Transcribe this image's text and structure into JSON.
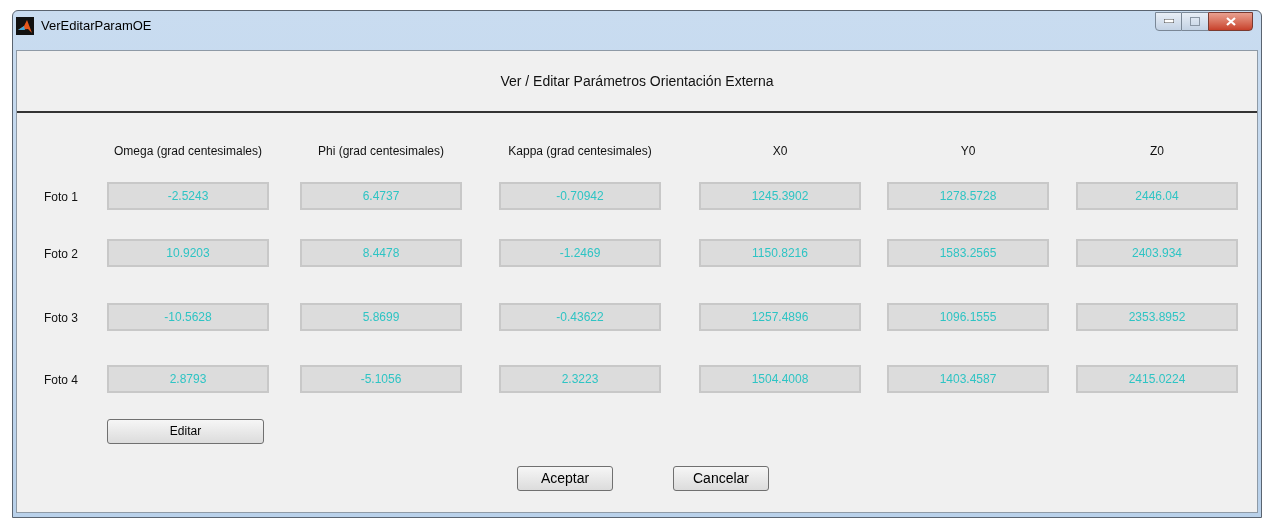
{
  "window": {
    "title": "VerEditarParamOE"
  },
  "header": "Ver / Editar Parámetros Orientación Externa",
  "columns": [
    "Omega (grad centesimales)",
    "Phi (grad centesimales)",
    "Kappa (grad centesimales)",
    "X0",
    "Y0",
    "Z0"
  ],
  "rows": [
    {
      "label": "Foto 1",
      "values": [
        "-2.5243",
        "6.4737",
        "-0.70942",
        "1245.3902",
        "1278.5728",
        "2446.04"
      ]
    },
    {
      "label": "Foto 2",
      "values": [
        "10.9203",
        "8.4478",
        "-1.2469",
        "1150.8216",
        "1583.2565",
        "2403.934"
      ]
    },
    {
      "label": "Foto 3",
      "values": [
        "-10.5628",
        "5.8699",
        "-0.43622",
        "1257.4896",
        "1096.1555",
        "2353.8952"
      ]
    },
    {
      "label": "Foto 4",
      "values": [
        "2.8793",
        "-5.1056",
        "2.3223",
        "1504.4008",
        "1403.4587",
        "2415.0224"
      ]
    }
  ],
  "edit_button": "Editar",
  "buttons": [
    "Aceptar",
    "Cancelar"
  ]
}
